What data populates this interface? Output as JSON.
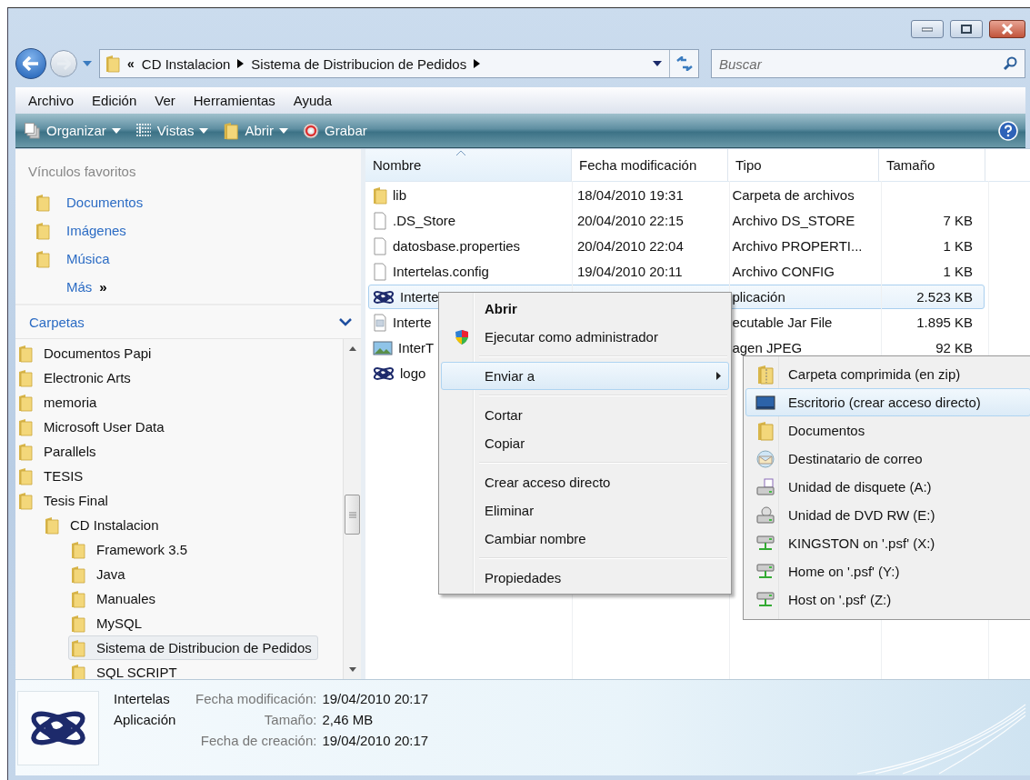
{
  "address": {
    "overflow": "«",
    "crumbs": [
      "CD Instalacion",
      "Sistema de Distribucion de Pedidos"
    ]
  },
  "search": {
    "placeholder": "Buscar"
  },
  "menu_bar": [
    "Archivo",
    "Edición",
    "Ver",
    "Herramientas",
    "Ayuda"
  ],
  "toolbar": [
    {
      "label": "Organizar",
      "kind": "pages",
      "dropdown": true
    },
    {
      "label": "Vistas",
      "kind": "list",
      "dropdown": true
    },
    {
      "label": "Abrir",
      "kind": "folder",
      "dropdown": true
    },
    {
      "label": "Grabar",
      "kind": "disc",
      "dropdown": false
    }
  ],
  "favorites": {
    "title": "Vínculos favoritos",
    "links": [
      "Documentos",
      "Imágenes",
      "Música"
    ],
    "more": {
      "label": "Más",
      "glyph": "»"
    }
  },
  "folders": {
    "title": "Carpetas",
    "tree": [
      {
        "label": "Documentos Papi",
        "selected": false
      },
      {
        "label": "Electronic Arts",
        "selected": false
      },
      {
        "label": "memoria",
        "selected": false
      },
      {
        "label": "Microsoft User Data",
        "selected": false
      },
      {
        "label": "Parallels",
        "selected": false
      },
      {
        "label": "TESIS",
        "selected": false
      },
      {
        "label": "Tesis Final",
        "selected": false,
        "children": [
          {
            "label": "CD Instalacion",
            "selected": false,
            "children": [
              {
                "label": "Framework 3.5",
                "selected": false
              },
              {
                "label": "Java",
                "selected": false
              },
              {
                "label": "Manuales",
                "selected": false
              },
              {
                "label": "MySQL",
                "selected": false
              },
              {
                "label": "Sistema de Distribucion de Pedidos",
                "selected": true
              },
              {
                "label": "SQL SCRIPT",
                "selected": false
              }
            ]
          }
        ]
      }
    ]
  },
  "columns": [
    {
      "label": "Nombre",
      "sorted": true
    },
    {
      "label": "Fecha modificación",
      "sorted": false
    },
    {
      "label": "Tipo",
      "sorted": false
    },
    {
      "label": "Tamaño",
      "sorted": false
    }
  ],
  "files": [
    {
      "kind": "folder",
      "name": "lib",
      "date": "18/04/2010 19:31",
      "type": "Carpeta de archivos",
      "selected": false
    },
    {
      "kind": "file",
      "name": ".DS_Store",
      "date": "20/04/2010 22:15",
      "type": "Archivo DS_STORE",
      "size": "7 KB",
      "selected": false
    },
    {
      "kind": "file",
      "name": "datosbase.properties",
      "date": "20/04/2010 22:04",
      "type": "Archivo PROPERTI...",
      "size": "1 KB",
      "selected": false
    },
    {
      "kind": "file",
      "name": "Intertelas.config",
      "date": "19/04/2010 20:11",
      "type": "Archivo CONFIG",
      "size": "1 KB",
      "selected": false
    },
    {
      "kind": "app",
      "name": "Interte",
      "type": "plicación",
      "size": "2.523 KB",
      "selected": true
    },
    {
      "kind": "jar",
      "name": "Interte",
      "type": "ecutable Jar File",
      "size": "1.895 KB",
      "selected": false
    },
    {
      "kind": "image",
      "name": "InterT",
      "type": "agen JPEG",
      "size": "92 KB",
      "selected": false
    },
    {
      "kind": "app",
      "name": "logo",
      "selected": false
    }
  ],
  "context_menu": {
    "groups": [
      [
        {
          "label": "Abrir",
          "kind": "plain",
          "default": true,
          "selected": false,
          "submenu": false
        },
        {
          "label": "Ejecutar como administrador",
          "kind": "admin",
          "default": false,
          "selected": false,
          "submenu": false
        }
      ],
      [
        {
          "label": "Enviar a",
          "kind": "plain",
          "default": false,
          "selected": true,
          "submenu": true
        }
      ],
      [
        {
          "label": "Cortar",
          "kind": "plain",
          "default": false,
          "selected": false,
          "submenu": false
        },
        {
          "label": "Copiar",
          "kind": "plain",
          "default": false,
          "selected": false,
          "submenu": false
        }
      ],
      [
        {
          "label": "Crear acceso directo",
          "kind": "plain",
          "default": false,
          "selected": false,
          "submenu": false
        },
        {
          "label": "Eliminar",
          "kind": "plain",
          "default": false,
          "selected": false,
          "submenu": false
        },
        {
          "label": "Cambiar nombre",
          "kind": "plain",
          "default": false,
          "selected": false,
          "submenu": false
        }
      ],
      [
        {
          "label": "Propiedades",
          "kind": "plain",
          "default": false,
          "selected": false,
          "submenu": false
        }
      ]
    ]
  },
  "send_to": [
    {
      "label": "Carpeta comprimida (en zip)",
      "kind": "zip",
      "selected": false
    },
    {
      "label": "Escritorio (crear acceso directo)",
      "kind": "desktop",
      "selected": true
    },
    {
      "label": "Documentos",
      "kind": "folder",
      "selected": false
    },
    {
      "label": "Destinatario de correo",
      "kind": "mail",
      "selected": false
    },
    {
      "label": "Unidad de disquete (A:)",
      "kind": "floppy",
      "selected": false
    },
    {
      "label": "Unidad de DVD RW (E:)",
      "kind": "dvd",
      "selected": false
    },
    {
      "label": "KINGSTON on '.psf' (X:)",
      "kind": "network",
      "selected": false
    },
    {
      "label": "Home on '.psf' (Y:)",
      "kind": "network",
      "selected": false
    },
    {
      "label": "Host on '.psf' (Z:)",
      "kind": "network",
      "selected": false
    }
  ],
  "details": {
    "name": "Intertelas",
    "type": "Aplicación",
    "properties": [
      {
        "label": "Fecha modificación:",
        "value": "19/04/2010 20:17"
      },
      {
        "label": "Tamaño:",
        "value": "2,46 MB"
      },
      {
        "label": "Fecha de creación:",
        "value": "19/04/2010 20:17"
      }
    ]
  }
}
